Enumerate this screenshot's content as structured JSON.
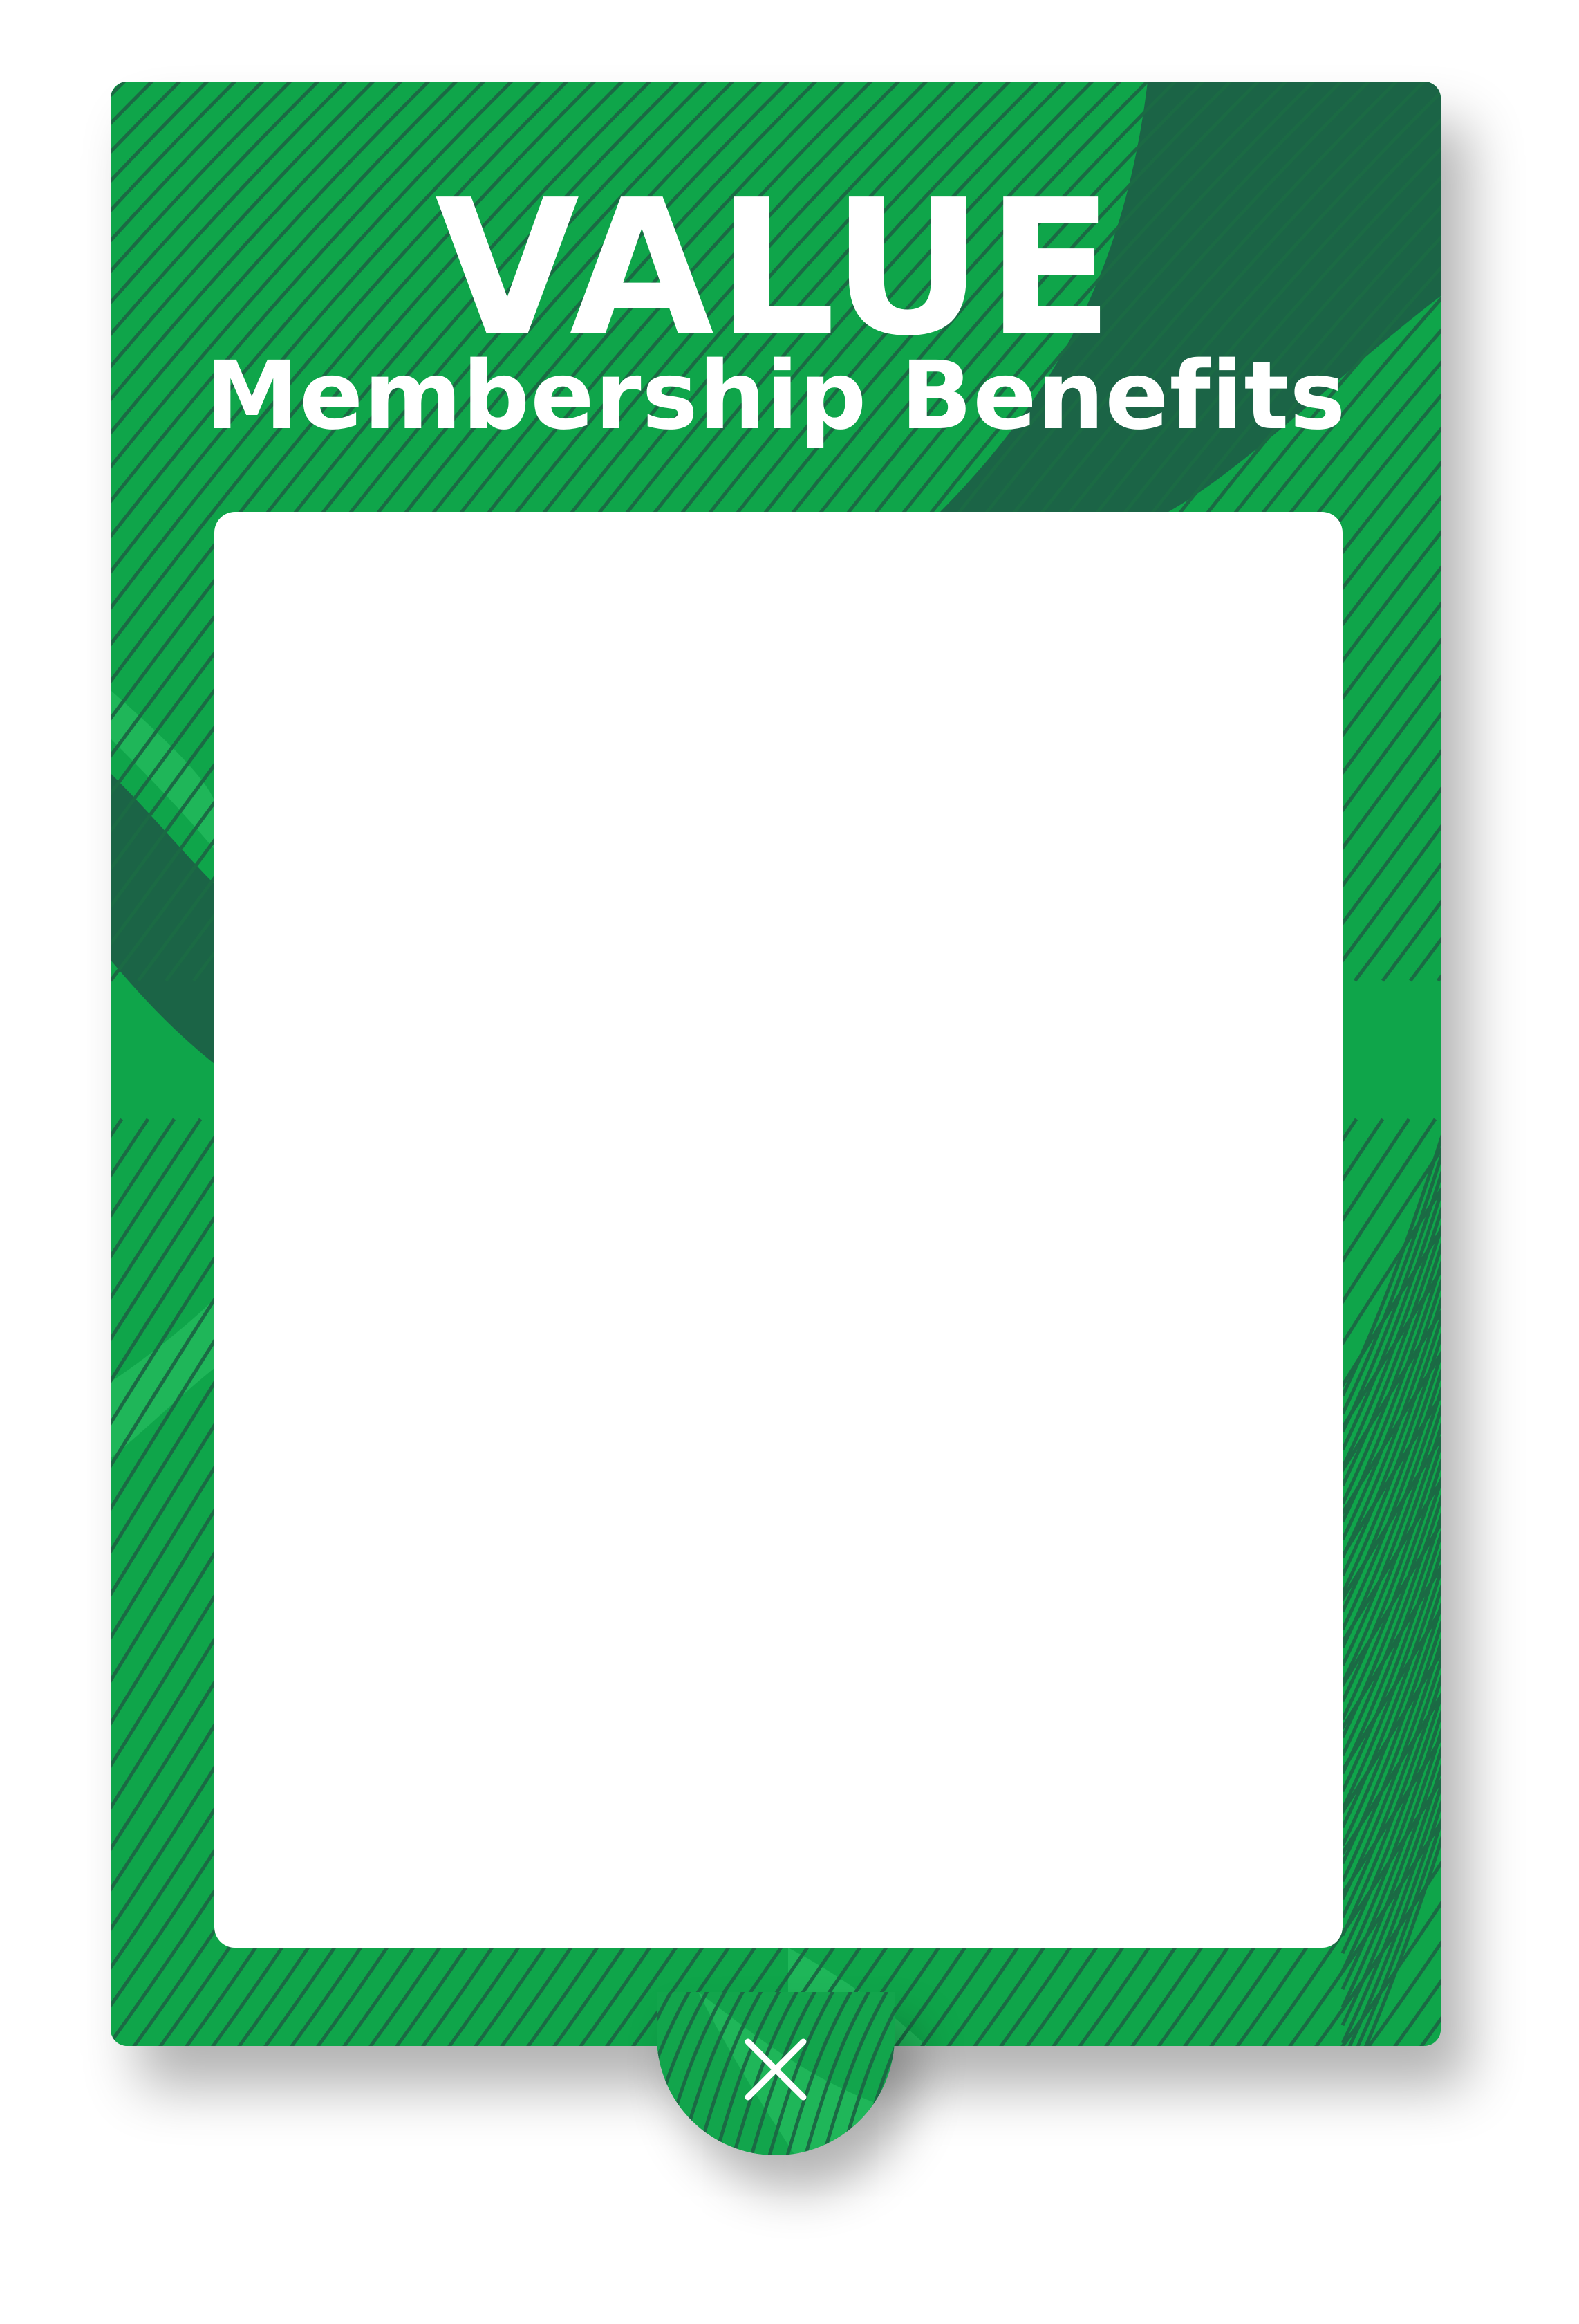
{
  "card": {
    "title": "VALUE",
    "subtitle": "Membership Benefits"
  },
  "close_button": {
    "icon": "close-icon"
  },
  "colors": {
    "primary_green": "#0fa54a",
    "dark_green": "#1b6446",
    "line_green": "#1b6a44",
    "panel_white": "#ffffff",
    "text_white": "#ffffff"
  }
}
